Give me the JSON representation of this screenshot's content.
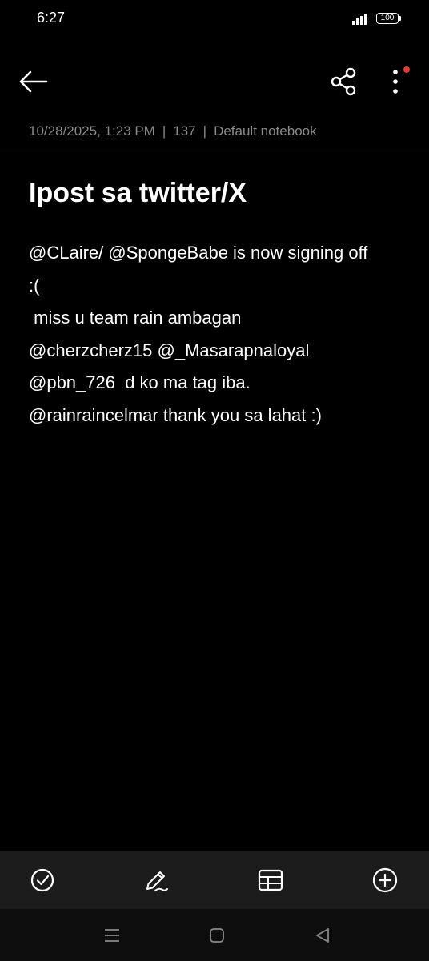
{
  "status_bar": {
    "time": "6:27",
    "battery_level": "100",
    "signal_icon": "signal-bars-icon"
  },
  "toolbar": {
    "back_icon": "arrow-left-icon",
    "share_icon": "share-icon",
    "more_icon": "more-vertical-icon",
    "notification_dot_color": "#e53935"
  },
  "meta": {
    "date": "10/28/2025, 1:23 PM",
    "separator": "|",
    "char_count": "137",
    "notebook": "Default notebook"
  },
  "note": {
    "title": "Ipost sa twitter/X",
    "lines": [
      "@CLaire/ @SpongeBabe is now signing off",
      ":(",
      " miss u team rain ambagan",
      "@cherzcherz15 @_Masarapnaloyal",
      "@pbn_726  d ko ma tag iba.",
      "@rainraincelmar thank you sa lahat :)"
    ]
  },
  "bottom_toolbar": {
    "items": [
      {
        "icon": "checkbox-circle-icon"
      },
      {
        "icon": "pen-icon"
      },
      {
        "icon": "table-icon"
      },
      {
        "icon": "add-circle-icon"
      }
    ]
  },
  "nav_bar": {
    "recents_icon": "recents-icon",
    "home_icon": "home-icon",
    "back_icon": "nav-back-icon"
  },
  "colors": {
    "background": "#000000",
    "text": "#ffffff",
    "meta_text": "#8a8a8a",
    "bottom_toolbar_bg": "#1c1c1c",
    "nav_bar_bg": "#0e0e0e"
  }
}
